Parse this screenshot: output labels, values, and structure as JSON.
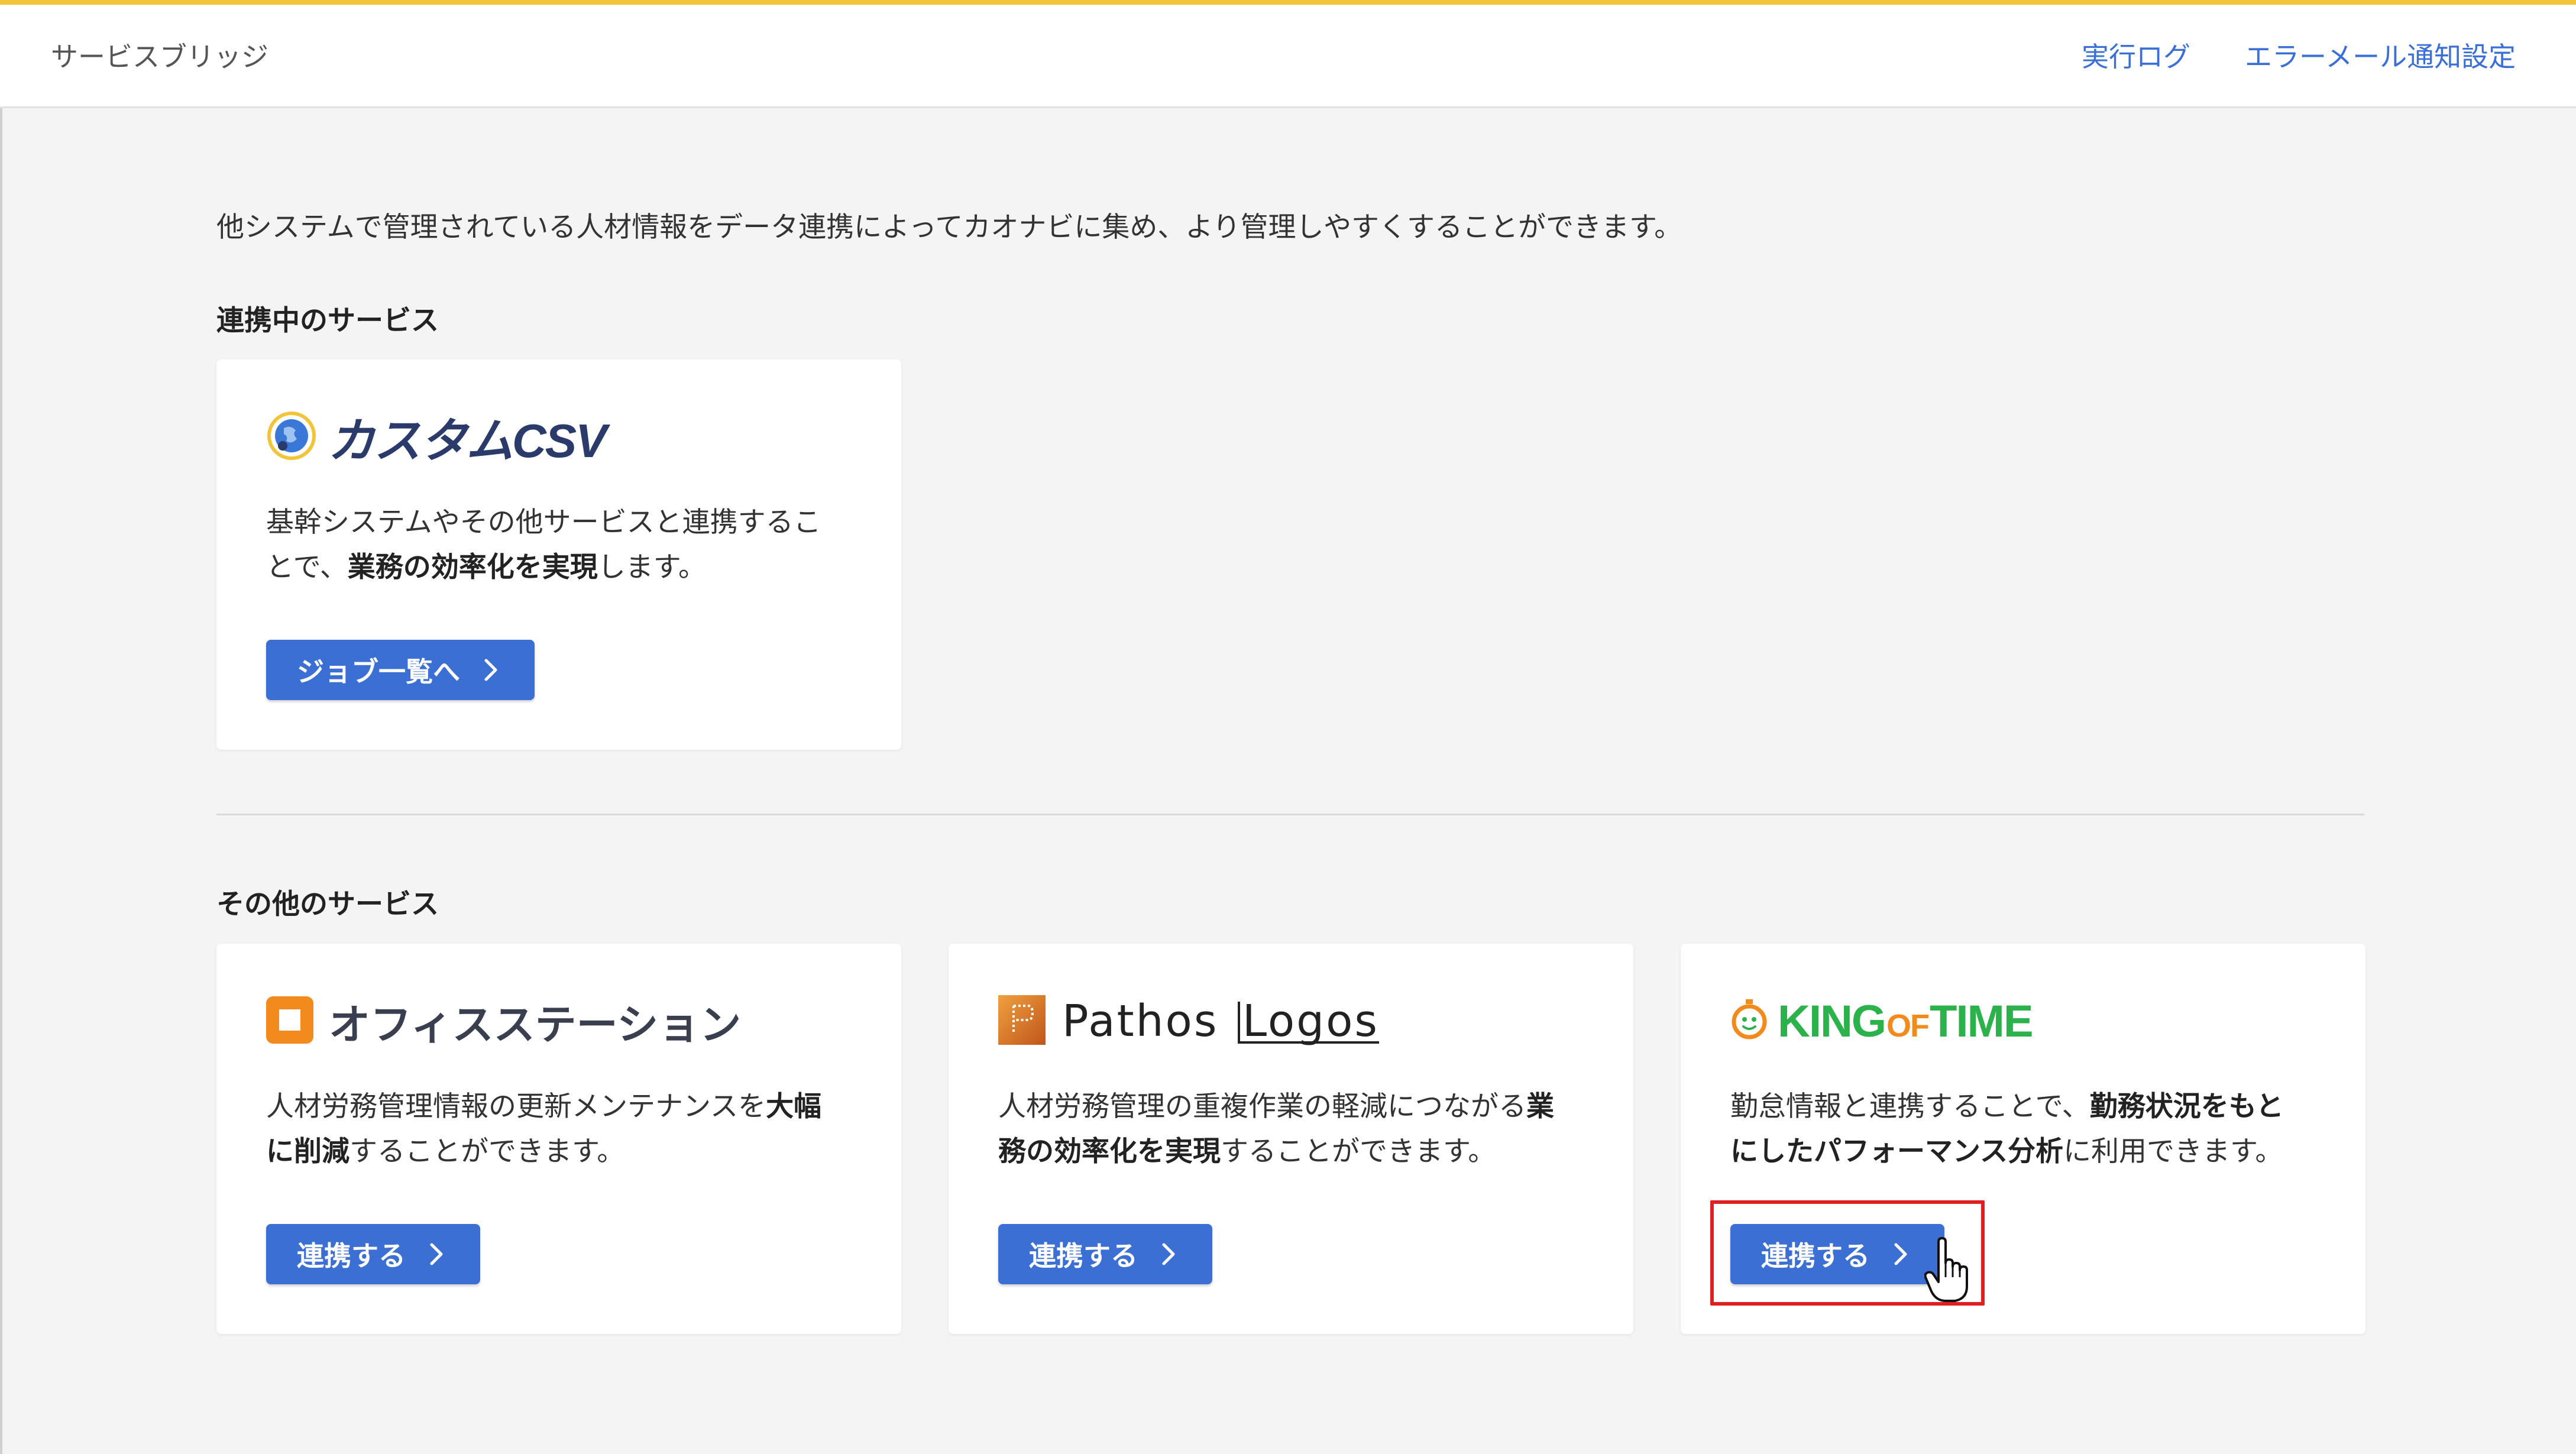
{
  "header": {
    "title": "サービスブリッジ",
    "links": [
      {
        "label": "実行ログ"
      },
      {
        "label": "エラーメール通知設定"
      }
    ]
  },
  "intro": "他システムで管理されている人材情報をデータ連携によってカオナビに集め、より管理しやすくすることができます。",
  "connected_section": {
    "heading": "連携中のサービス",
    "cards": [
      {
        "logo_icon": "globe-icon",
        "logo_text": "カスタムCSV",
        "desc_line1": "基幹システムやその他サービスと連携するこ",
        "desc_line2_pre": "とで、",
        "desc_line2_bold": "業務の効率化を実現",
        "desc_line2_post": "します。",
        "button_label": "ジョブ一覧へ"
      }
    ]
  },
  "other_section": {
    "heading": "その他のサービス",
    "cards": [
      {
        "logo_icon": "office-station-icon",
        "logo_text": "オフィスステーション",
        "desc_line1_pre": "人材労務管理情報の更新メンテナンスを",
        "desc_line1_bold": "大幅",
        "desc_line2_bold": "に削減",
        "desc_line2_post": "することができます。",
        "button_label": "連携する"
      },
      {
        "logo_icon": "pathos-logos-icon",
        "logo_text_a": "Pathos",
        "logo_text_b": "Logos",
        "desc_line1_pre": "人材労務管理の重複作業の軽減につながる",
        "desc_line1_bold": "業",
        "desc_line2_bold": "務の効率化を実現",
        "desc_line2_post": "することができます。",
        "button_label": "連携する"
      },
      {
        "logo_icon": "king-of-time-icon",
        "logo_text_a": "KING",
        "logo_text_b": "OF",
        "logo_text_c": "TIME",
        "desc_line1_pre": "勤怠情報と連携することで、",
        "desc_line1_bold": "勤務状況をもと",
        "desc_line2_bold": "にしたパフォーマンス分析",
        "desc_line2_post": "に利用できます。",
        "button_label": "連携する"
      }
    ]
  },
  "colors": {
    "accent": "#f2c43a",
    "link": "#3a6fd8",
    "button": "#3b6fd4",
    "highlight": "#e02020",
    "kot_green": "#2bb24a",
    "office_orange": "#f28a1c"
  }
}
